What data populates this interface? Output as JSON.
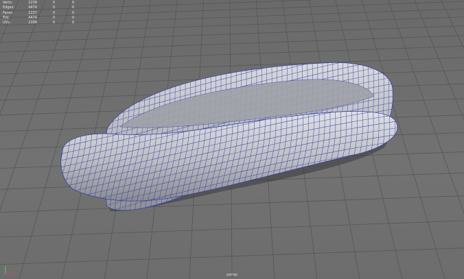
{
  "hud": {
    "rows": [
      {
        "label": "Verts:",
        "values": [
          "2239",
          "0",
          "0"
        ]
      },
      {
        "label": "Edges:",
        "values": [
          "4474",
          "0",
          "0"
        ]
      },
      {
        "label": "Faces:",
        "values": [
          "2237",
          "0",
          "0"
        ]
      },
      {
        "label": "Tris:",
        "values": [
          "4474",
          "0",
          "0"
        ]
      },
      {
        "label": "UVs:",
        "values": [
          "2308",
          "0",
          "0"
        ]
      }
    ]
  },
  "camera": {
    "label": "persp"
  },
  "colors": {
    "background": "#6f6f6f",
    "grid": "#565656",
    "mesh_fill": "#b4b6bc",
    "wire": "#3a3fa0",
    "hud_text": "#e9e9e9"
  }
}
